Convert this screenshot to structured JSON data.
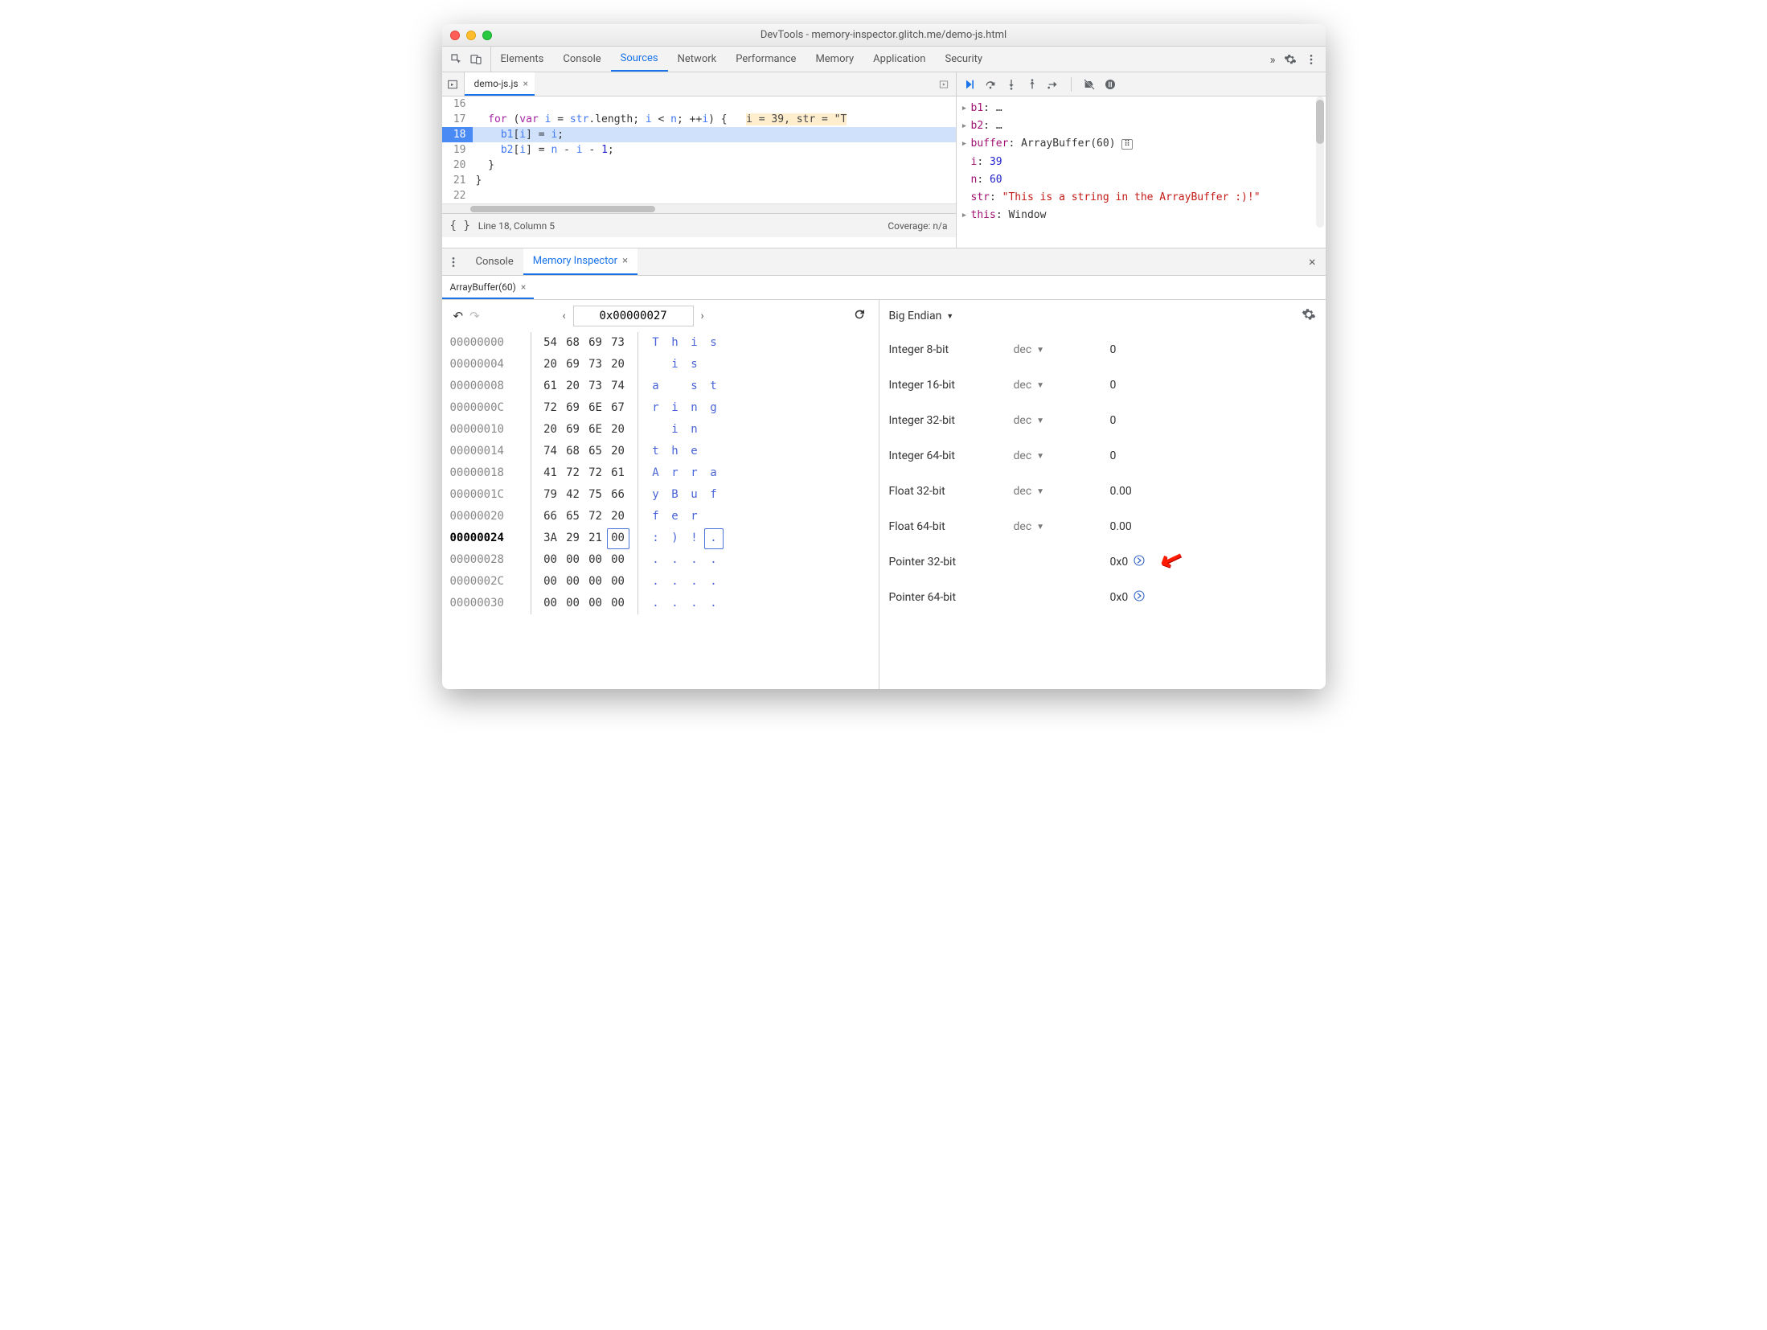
{
  "window": {
    "title": "DevTools - memory-inspector.glitch.me/demo-js.html"
  },
  "toolbar": {
    "tabs": [
      "Elements",
      "Console",
      "Sources",
      "Network",
      "Performance",
      "Memory",
      "Application",
      "Security"
    ],
    "active_index": 2,
    "more_glyph": "»"
  },
  "file_tab": {
    "name": "demo-js.js",
    "close": "×"
  },
  "code": {
    "lines": [
      {
        "n": 16,
        "txt": ""
      },
      {
        "n": 17,
        "txt_html": "  <span class='kw'>for</span> (<span class='kw'>var</span> <span class='var'>i</span> = <span class='var'>str</span>.length; <span class='var'>i</span> &lt; <span class='var'>n</span>; ++<span class='var'>i</span>) {   <span class='inlinevar'>i = 39, str = \"T</span>"
      },
      {
        "n": 18,
        "active": true,
        "txt_html": "    <span class='var'>b1</span>[<span class='var'>i</span>] = <span class='var'>i</span>;"
      },
      {
        "n": 19,
        "txt_html": "    <span class='var'>b2</span>[<span class='var'>i</span>] = <span class='var'>n</span> - <span class='var'>i</span> - <span class='num'>1</span>;"
      },
      {
        "n": 20,
        "txt_html": "  }"
      },
      {
        "n": 21,
        "txt_html": "}"
      },
      {
        "n": 22,
        "txt_html": ""
      }
    ]
  },
  "status": {
    "position": "Line 18, Column 5",
    "coverage": "Coverage: n/a"
  },
  "scope": {
    "items": [
      {
        "prop": "b1",
        "val": "…",
        "kind": "obj"
      },
      {
        "prop": "b2",
        "val": "…",
        "kind": "obj"
      },
      {
        "prop": "buffer",
        "val": "ArrayBuffer(60)",
        "kind": "obj",
        "extra_icon": true
      },
      {
        "prop": "i",
        "val": "39",
        "kind": "num",
        "indent": true
      },
      {
        "prop": "n",
        "val": "60",
        "kind": "num",
        "indent": true
      },
      {
        "prop": "str",
        "val": "\"This is a string in the ArrayBuffer :)!\"",
        "kind": "str",
        "indent": true
      },
      {
        "prop": "this",
        "val": "Window",
        "kind": "obj"
      }
    ]
  },
  "drawer": {
    "tabs": [
      "Console",
      "Memory Inspector"
    ],
    "active_index": 1,
    "close": "×"
  },
  "mi": {
    "tab_label": "ArrayBuffer(60)",
    "tab_close": "×",
    "address": "0x00000027",
    "hexrows": [
      {
        "off": "00000000",
        "hex": [
          "54",
          "68",
          "69",
          "73"
        ],
        "asc": [
          "T",
          "h",
          "i",
          "s"
        ]
      },
      {
        "off": "00000004",
        "hex": [
          "20",
          "69",
          "73",
          "20"
        ],
        "asc": [
          " ",
          "i",
          "s",
          " "
        ]
      },
      {
        "off": "00000008",
        "hex": [
          "61",
          "20",
          "73",
          "74"
        ],
        "asc": [
          "a",
          " ",
          "s",
          "t"
        ]
      },
      {
        "off": "0000000C",
        "hex": [
          "72",
          "69",
          "6E",
          "67"
        ],
        "asc": [
          "r",
          "i",
          "n",
          "g"
        ]
      },
      {
        "off": "00000010",
        "hex": [
          "20",
          "69",
          "6E",
          "20"
        ],
        "asc": [
          " ",
          "i",
          "n",
          " "
        ]
      },
      {
        "off": "00000014",
        "hex": [
          "74",
          "68",
          "65",
          "20"
        ],
        "asc": [
          "t",
          "h",
          "e",
          " "
        ]
      },
      {
        "off": "00000018",
        "hex": [
          "41",
          "72",
          "72",
          "61"
        ],
        "asc": [
          "A",
          "r",
          "r",
          "a"
        ]
      },
      {
        "off": "0000001C",
        "hex": [
          "79",
          "42",
          "75",
          "66"
        ],
        "asc": [
          "y",
          "B",
          "u",
          "f"
        ]
      },
      {
        "off": "00000020",
        "hex": [
          "66",
          "65",
          "72",
          "20"
        ],
        "asc": [
          "f",
          "e",
          "r",
          " "
        ]
      },
      {
        "off": "00000024",
        "hex": [
          "3A",
          "29",
          "21",
          "00"
        ],
        "asc": [
          ":",
          ")",
          "!",
          "."
        ],
        "current": true,
        "sel_hex": 3,
        "sel_asc": 3
      },
      {
        "off": "00000028",
        "hex": [
          "00",
          "00",
          "00",
          "00"
        ],
        "asc": [
          ".",
          ".",
          ".",
          "."
        ]
      },
      {
        "off": "0000002C",
        "hex": [
          "00",
          "00",
          "00",
          "00"
        ],
        "asc": [
          ".",
          ".",
          ".",
          "."
        ]
      },
      {
        "off": "00000030",
        "hex": [
          "00",
          "00",
          "00",
          "00"
        ],
        "asc": [
          ".",
          ".",
          ".",
          "."
        ]
      }
    ]
  },
  "values": {
    "endianness": "Big Endian",
    "rows": [
      {
        "label": "Integer 8-bit",
        "mode": "dec",
        "value": "0"
      },
      {
        "label": "Integer 16-bit",
        "mode": "dec",
        "value": "0"
      },
      {
        "label": "Integer 32-bit",
        "mode": "dec",
        "value": "0"
      },
      {
        "label": "Integer 64-bit",
        "mode": "dec",
        "value": "0"
      },
      {
        "label": "Float 32-bit",
        "mode": "dec",
        "value": "0.00"
      },
      {
        "label": "Float 64-bit",
        "mode": "dec",
        "value": "0.00"
      },
      {
        "label": "Pointer 32-bit",
        "mode": "",
        "value": "0x0",
        "jump": true,
        "arrow": true
      },
      {
        "label": "Pointer 64-bit",
        "mode": "",
        "value": "0x0",
        "jump": true
      }
    ]
  }
}
